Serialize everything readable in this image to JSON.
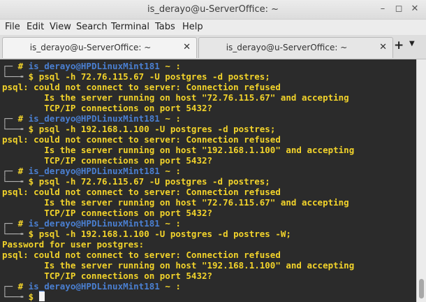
{
  "window": {
    "title": "is_derayo@u-ServerOffice: ~"
  },
  "menu": [
    "File",
    "Edit",
    "View",
    "Search",
    "Terminal",
    "Tabs",
    "Help"
  ],
  "tabs": [
    {
      "label": "is_derayo@u-ServerOffice: ~",
      "active": true
    },
    {
      "label": "is_derayo@u-ServerOffice: ~",
      "active": false
    }
  ],
  "icons": {
    "minimize": "minimize-icon",
    "maximize": "maximize-icon",
    "close": "close-icon",
    "add_tab": "plus-icon",
    "tab_menu": "chevron-down-icon"
  },
  "terminal": {
    "prompt_user": "is_derayo",
    "prompt_host": "@HPDLinuxMint181",
    "prompt_suffix": " ~ :",
    "lines": [
      {
        "kind": "prompt"
      },
      {
        "kind": "cmd",
        "text": "psql -h 72.76.115.67 -U postgres -d postres;"
      },
      {
        "kind": "out",
        "text": "psql: could not connect to server: Connection refused"
      },
      {
        "kind": "out",
        "text": "        Is the server running on host \"72.76.115.67\" and accepting"
      },
      {
        "kind": "out",
        "text": "        TCP/IP connections on port 5432?"
      },
      {
        "kind": "prompt"
      },
      {
        "kind": "cmd",
        "text": "psql -h 192.168.1.100 -U postgres -d postres;"
      },
      {
        "kind": "out",
        "text": "psql: could not connect to server: Connection refused"
      },
      {
        "kind": "out",
        "text": "        Is the server running on host \"192.168.1.100\" and accepting"
      },
      {
        "kind": "out",
        "text": "        TCP/IP connections on port 5432?"
      },
      {
        "kind": "prompt"
      },
      {
        "kind": "cmd",
        "text": "psql -h 72.76.115.67 -U postgres -d postres;"
      },
      {
        "kind": "out",
        "text": "psql: could not connect to server: Connection refused"
      },
      {
        "kind": "out",
        "text": "        Is the server running on host \"72.76.115.67\" and accepting"
      },
      {
        "kind": "out",
        "text": "        TCP/IP connections on port 5432?"
      },
      {
        "kind": "prompt"
      },
      {
        "kind": "cmd",
        "text": "psql -h 192.168.1.100 -U postgres -d postres -W;"
      },
      {
        "kind": "out",
        "text": "Password for user postgres:"
      },
      {
        "kind": "out",
        "text": "psql: could not connect to server: Connection refused"
      },
      {
        "kind": "out",
        "text": "        Is the server running on host \"192.168.1.100\" and accepting"
      },
      {
        "kind": "out",
        "text": "        TCP/IP connections on port 5432?"
      },
      {
        "kind": "prompt"
      },
      {
        "kind": "cmd",
        "text": ""
      }
    ],
    "colors": {
      "text": "#f2d32b",
      "user": "#4a7fd1",
      "background": "#2b2b2b"
    }
  }
}
